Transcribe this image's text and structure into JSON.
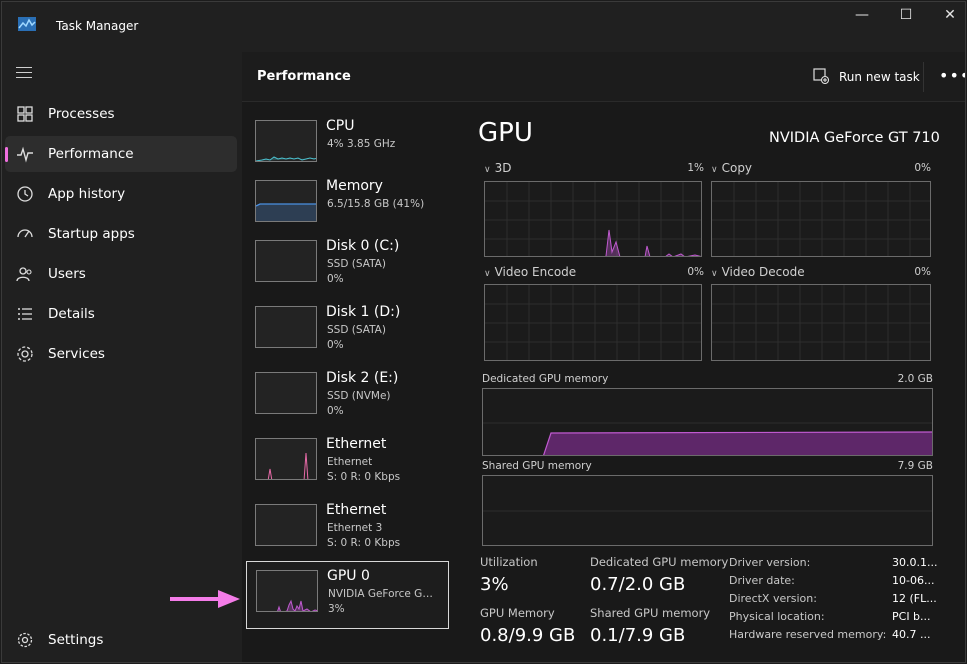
{
  "app": {
    "title": "Task Manager"
  },
  "window_controls": {
    "minimize": "—",
    "maximize": "☐",
    "close": "✕"
  },
  "nav": {
    "items": [
      {
        "label": "Processes",
        "icon": "processes-icon"
      },
      {
        "label": "Performance",
        "icon": "performance-icon",
        "active": true
      },
      {
        "label": "App history",
        "icon": "history-icon"
      },
      {
        "label": "Startup apps",
        "icon": "startup-icon"
      },
      {
        "label": "Users",
        "icon": "users-icon"
      },
      {
        "label": "Details",
        "icon": "details-icon"
      },
      {
        "label": "Services",
        "icon": "services-icon"
      }
    ],
    "settings": "Settings"
  },
  "header": {
    "title": "Performance",
    "run_task": "Run new task",
    "more": "•••"
  },
  "devices": [
    {
      "name": "CPU",
      "sub": "4% 3.85 GHz",
      "sub2": ""
    },
    {
      "name": "Memory",
      "sub": "6.5/15.8 GB (41%)",
      "sub2": ""
    },
    {
      "name": "Disk 0 (C:)",
      "sub": "SSD (SATA)",
      "sub2": "0%"
    },
    {
      "name": "Disk 1 (D:)",
      "sub": "SSD (SATA)",
      "sub2": "0%"
    },
    {
      "name": "Disk 2 (E:)",
      "sub": "SSD (NVMe)",
      "sub2": "0%"
    },
    {
      "name": "Ethernet",
      "sub": "Ethernet",
      "sub2": "S: 0 R: 0 Kbps"
    },
    {
      "name": "Ethernet",
      "sub": "Ethernet 3",
      "sub2": "S: 0 R: 0 Kbps"
    },
    {
      "name": "GPU 0",
      "sub": "NVIDIA GeForce G…",
      "sub2": "3%",
      "selected": true
    }
  ],
  "detail": {
    "title": "GPU",
    "model": "NVIDIA GeForce GT 710",
    "engines": [
      {
        "name": "3D",
        "pct": "1%"
      },
      {
        "name": "Copy",
        "pct": "0%"
      },
      {
        "name": "Video Encode",
        "pct": "0%"
      },
      {
        "name": "Video Decode",
        "pct": "0%"
      }
    ],
    "dedicated": {
      "label": "Dedicated GPU memory",
      "max": "2.0 GB"
    },
    "shared": {
      "label": "Shared GPU memory",
      "max": "7.9 GB"
    },
    "stats": [
      {
        "label": "Utilization",
        "value": "3%"
      },
      {
        "label": "Dedicated GPU memory",
        "value": "0.7/2.0 GB"
      },
      {
        "label": "GPU Memory",
        "value": "0.8/9.9 GB"
      },
      {
        "label": "Shared GPU memory",
        "value": "0.1/7.9 GB"
      }
    ],
    "info": [
      {
        "k": "Driver version:",
        "v": "30.0.1..."
      },
      {
        "k": "Driver date:",
        "v": "10-06..."
      },
      {
        "k": "DirectX version:",
        "v": "12 (FL..."
      },
      {
        "k": "Physical location:",
        "v": "PCI b..."
      },
      {
        "k": "Hardware reserved memory:",
        "v": "40.7 ..."
      }
    ]
  },
  "colors": {
    "accent": "#f06fe0",
    "gpu_line": "#c05ad0",
    "mem_line": "#4a90e2",
    "cpu_line": "#4cc2d0",
    "arrow": "#f47ce8"
  }
}
